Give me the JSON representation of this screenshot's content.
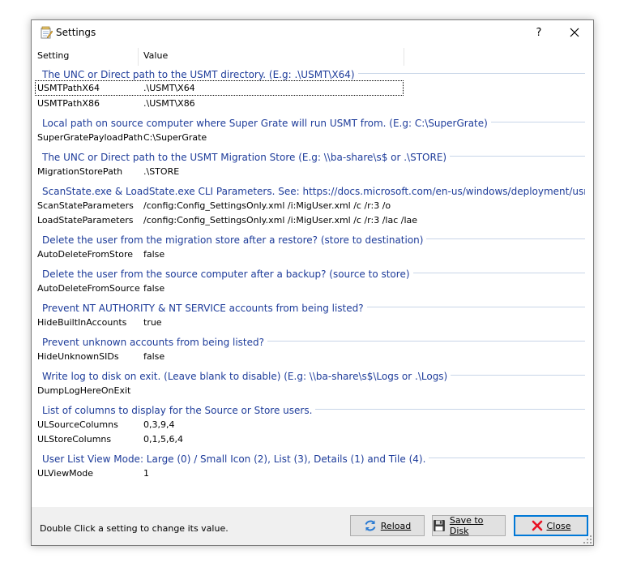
{
  "window": {
    "title": "Settings",
    "help": "?"
  },
  "columns": {
    "setting": "Setting",
    "value": "Value"
  },
  "sections": [
    {
      "header": "The UNC or Direct path to the USMT directory. (E.g: .\\USMT\\X64)",
      "rows": [
        {
          "k": "USMTPathX64",
          "v": ".\\USMT\\X64"
        },
        {
          "k": "USMTPathX86",
          "v": ".\\USMT\\X86"
        }
      ]
    },
    {
      "header": "Local path on source computer where Super Grate will run USMT from. (E.g: C:\\SuperGrate)",
      "rows": [
        {
          "k": "SuperGratePayloadPath",
          "v": "C:\\SuperGrate"
        }
      ]
    },
    {
      "header": "The UNC or Direct path to the USMT Migration Store (E.g: \\\\ba-share\\s$ or .\\STORE)",
      "rows": [
        {
          "k": "MigrationStorePath",
          "v": ".\\STORE"
        }
      ]
    },
    {
      "header": "ScanState.exe & LoadState.exe CLI Parameters. See: https://docs.microsoft.com/en-us/windows/deployment/usmt/usmt-co...",
      "rows": [
        {
          "k": "ScanStateParameters",
          "v": "/config:Config_SettingsOnly.xml /i:MigUser.xml /c /r:3 /o"
        },
        {
          "k": "LoadStateParameters",
          "v": "/config:Config_SettingsOnly.xml /i:MigUser.xml /c /r:3 /lac /lae"
        }
      ]
    },
    {
      "header": "Delete the user from the migration store after a restore? (store to destination)",
      "rows": [
        {
          "k": "AutoDeleteFromStore",
          "v": "false"
        }
      ]
    },
    {
      "header": "Delete the user from the source computer after a backup? (source to store)",
      "rows": [
        {
          "k": "AutoDeleteFromSource",
          "v": "false"
        }
      ]
    },
    {
      "header": "Prevent NT AUTHORITY & NT SERVICE accounts from being listed?",
      "rows": [
        {
          "k": "HideBuiltInAccounts",
          "v": "true"
        }
      ]
    },
    {
      "header": "Prevent unknown accounts from being listed?",
      "rows": [
        {
          "k": "HideUnknownSIDs",
          "v": "false"
        }
      ]
    },
    {
      "header": "Write log to disk on exit. (Leave blank to disable) (E.g: \\\\ba-share\\s$\\Logs or .\\Logs)",
      "rows": [
        {
          "k": "DumpLogHereOnExit",
          "v": ""
        }
      ]
    },
    {
      "header": "List of columns to display for the Source or Store users.",
      "rows": [
        {
          "k": "ULSourceColumns",
          "v": "0,3,9,4"
        },
        {
          "k": "ULStoreColumns",
          "v": "0,1,5,6,4"
        }
      ]
    },
    {
      "header": "User List View Mode: Large (0) / Small Icon (2), List (3), Details (1) and Tile (4).",
      "rows": [
        {
          "k": "ULViewMode",
          "v": "1"
        }
      ]
    }
  ],
  "footer": {
    "status": "Double Click a setting to change its value.",
    "reload": "Reload",
    "save": "Save to Disk",
    "close": "Close"
  },
  "colors": {
    "group_header": "#1e3c9a",
    "accent": "#0078d7",
    "close_icon": "#e81123",
    "reload_icon": "#2a7bd3"
  }
}
